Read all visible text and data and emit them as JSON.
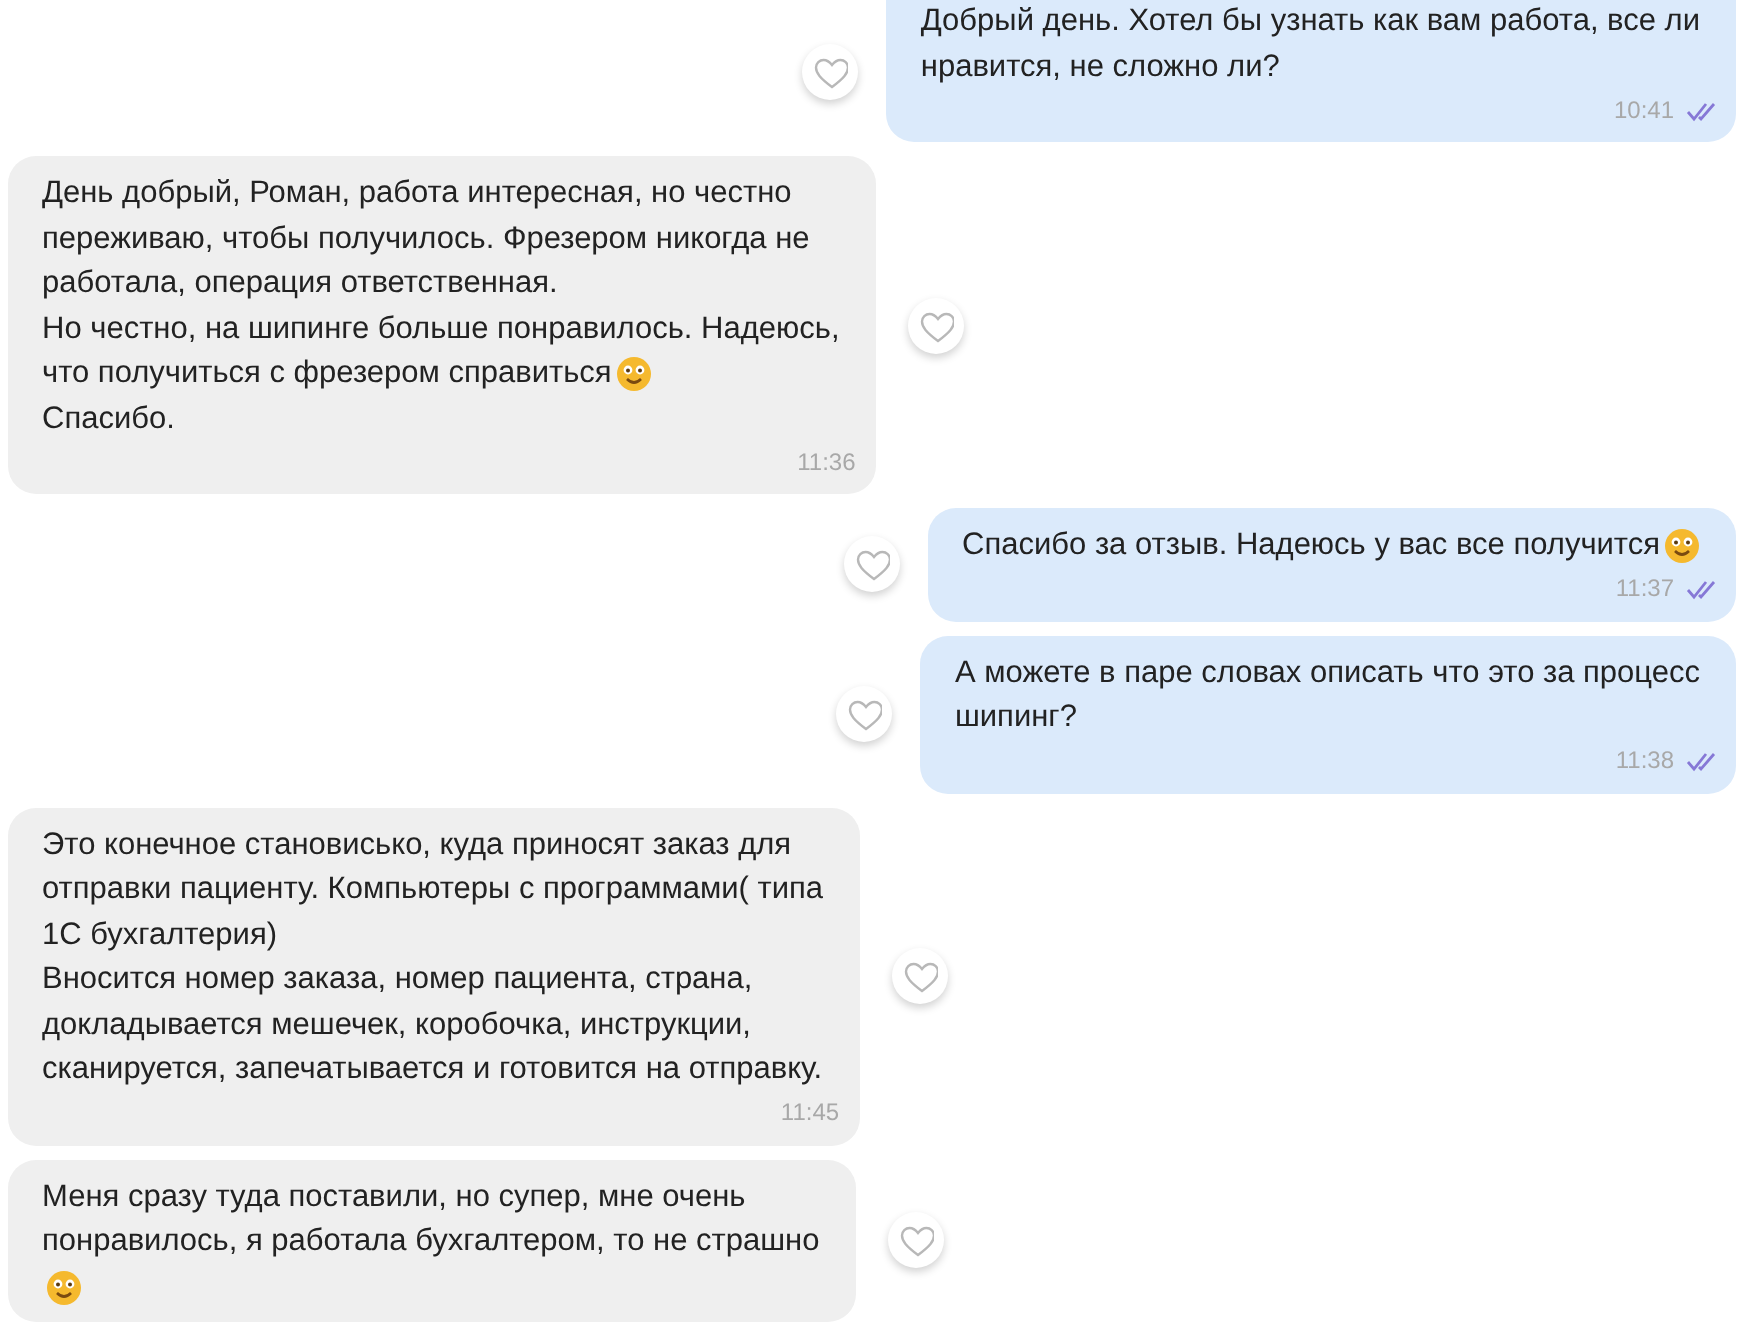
{
  "messages": [
    {
      "kind": "outgoing",
      "lines": [
        {
          "text": "Добрый день. Хотел бы узнать как вам работа, все ли"
        },
        {
          "text": "нравится, не сложно ли?"
        }
      ],
      "time": "10:41",
      "read": true
    },
    {
      "kind": "incoming",
      "lines": [
        {
          "text": "День добрый, Роман, работа интересная, но честно"
        },
        {
          "text": "переживаю, чтобы получилось. Фрезером никогда не"
        },
        {
          "text": "работала, операция ответственная."
        },
        {
          "text": "Но честно, на шипинге больше понравилось. Надеюсь,"
        },
        {
          "text": "что получиться с фрезером справиться",
          "emoji": true
        },
        {
          "text": "Спасибо."
        }
      ],
      "time": "11:36"
    },
    {
      "kind": "outgoing",
      "lines": [
        {
          "text": "Спасибо за отзыв. Надеюсь у вас все получится",
          "emoji": true
        }
      ],
      "time": "11:37",
      "read": true
    },
    {
      "kind": "outgoing",
      "lines": [
        {
          "text": "А можете в паре словах описать что это за процесс"
        },
        {
          "text": "шипинг?"
        }
      ],
      "time": "11:38",
      "read": true
    },
    {
      "kind": "incoming",
      "lines": [
        {
          "text": "Это конечное становисько, куда приносят заказ для"
        },
        {
          "text": "отправки пациенту. Компьютеры с программами( типа"
        },
        {
          "text": "1С бухгалтерия)"
        },
        {
          "text": "Вносится номер заказа, номер пациента, страна,"
        },
        {
          "text": "докладывается мешечек, коробочка, инструкции,"
        },
        {
          "text": "сканируется, запечатывается и готовится на отправку."
        }
      ],
      "time": "11:45"
    },
    {
      "kind": "incoming",
      "lines": [
        {
          "text": "Меня сразу туда поставили, но супер, мне очень"
        },
        {
          "text": "понравилось, я работала бухгалтером, то не страшно"
        },
        {
          "emoji": true
        }
      ]
    }
  ]
}
